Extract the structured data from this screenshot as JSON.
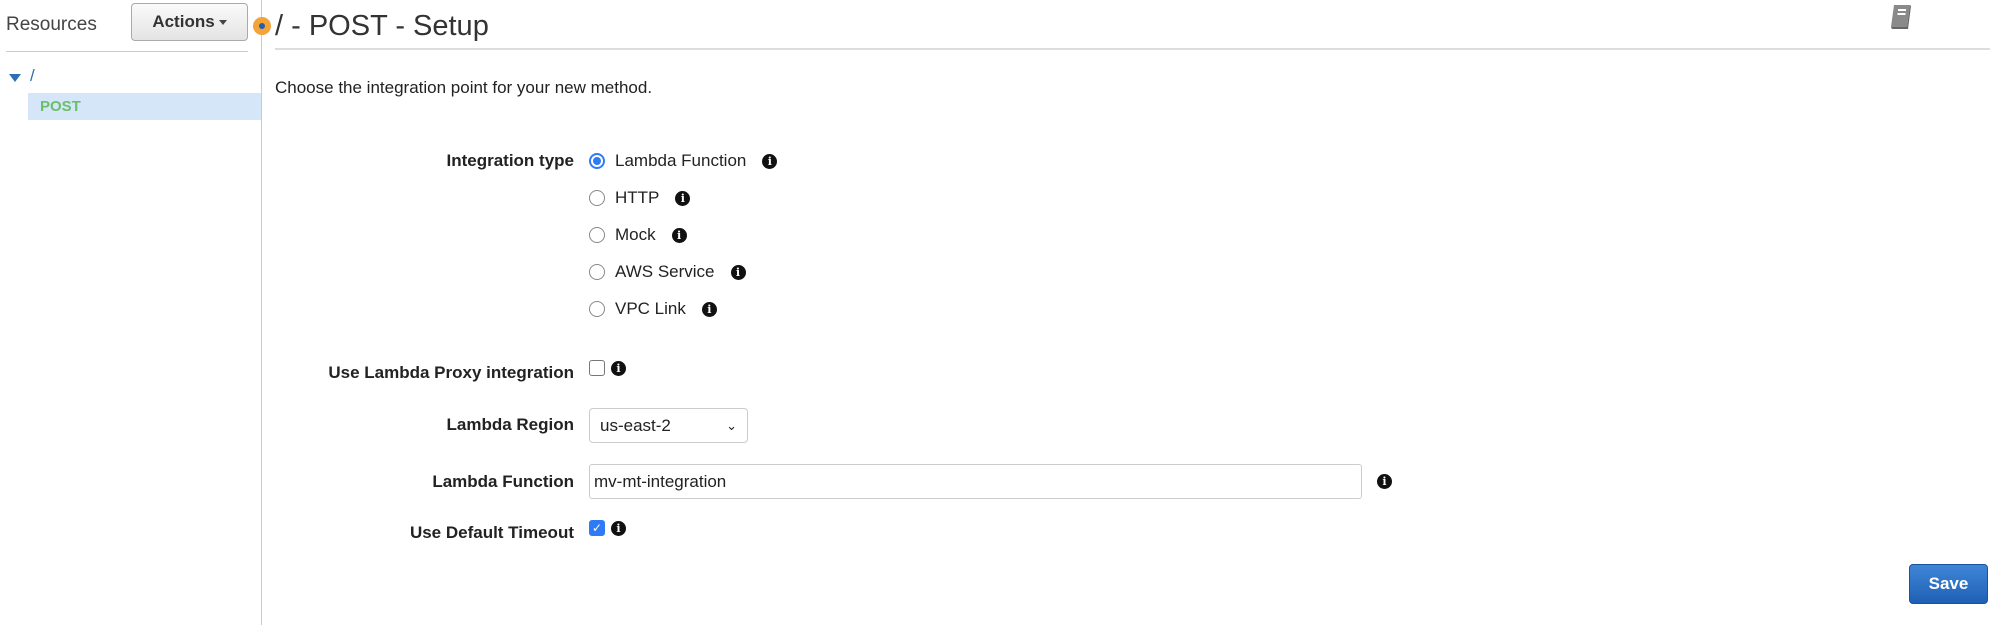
{
  "sidebar": {
    "title": "Resources",
    "actions_label": "Actions",
    "tree": {
      "root": "/",
      "method": "POST"
    }
  },
  "header": {
    "title": "/ - POST - Setup",
    "icon": "book-icon"
  },
  "main": {
    "intro": "Choose the integration point for your new method.",
    "integration_type": {
      "label": "Integration type",
      "options": [
        "Lambda Function",
        "HTTP",
        "Mock",
        "AWS Service",
        "VPC Link"
      ],
      "selected": "Lambda Function"
    },
    "proxy": {
      "label": "Use Lambda Proxy integration",
      "checked": false
    },
    "region": {
      "label": "Lambda Region",
      "value": "us-east-2"
    },
    "function": {
      "label": "Lambda Function",
      "value": "mv-mt-integration"
    },
    "timeout": {
      "label": "Use Default Timeout",
      "checked": true
    },
    "save_label": "Save"
  },
  "colors": {
    "accent": "#2f7bf5",
    "method": "#6abf6a",
    "save": "#2f6fc6"
  }
}
